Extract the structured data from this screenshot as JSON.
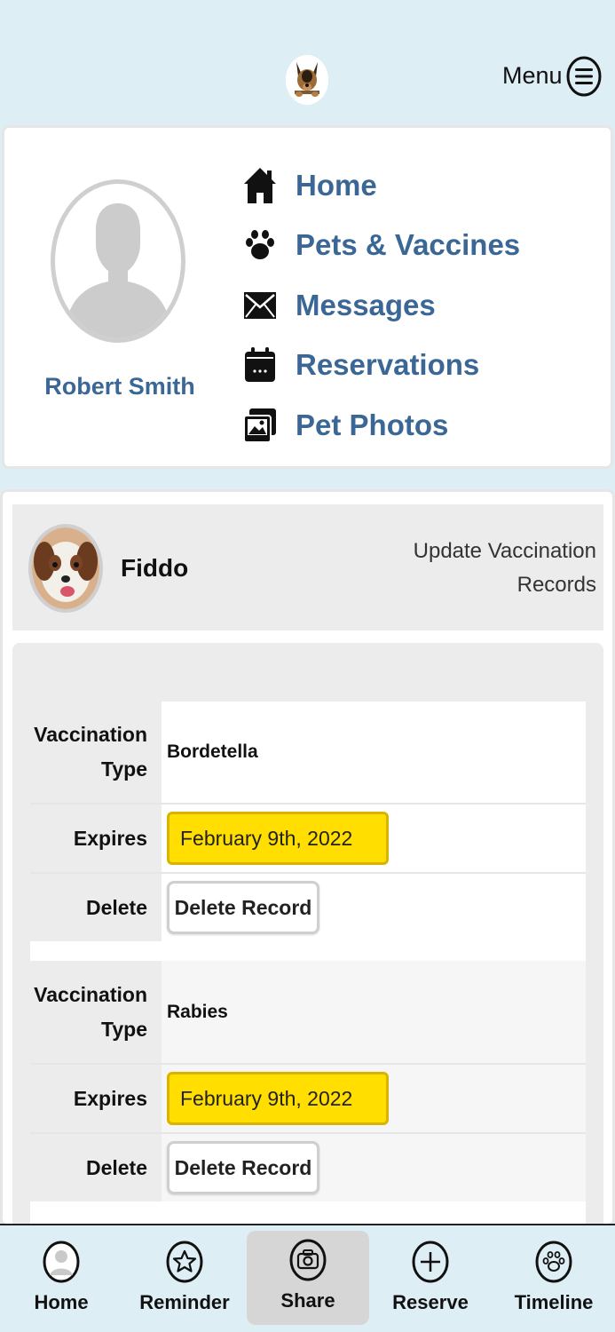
{
  "header": {
    "menu_label": "Menu"
  },
  "profile": {
    "user_name": "Robert Smith",
    "nav": [
      {
        "label": "Home",
        "icon": "home-icon"
      },
      {
        "label": "Pets & Vaccines",
        "icon": "paw-icon"
      },
      {
        "label": "Messages",
        "icon": "envelope-icon"
      },
      {
        "label": "Reservations",
        "icon": "calendar-icon"
      },
      {
        "label": "Pet Photos",
        "icon": "photos-icon"
      }
    ]
  },
  "pet": {
    "name": "Fiddo",
    "update_link": "Update Vaccination Records",
    "records": [
      {
        "type_label_line1": "Vaccination",
        "type_label_line2": "Type",
        "type_value": "Bordetella",
        "expires_label": "Expires",
        "expires_value": "February 9th, 2022",
        "delete_label": "Delete",
        "delete_button": "Delete Record"
      },
      {
        "type_label_line1": "Vaccination",
        "type_label_line2": "Type",
        "type_value": "Rabies",
        "expires_label": "Expires",
        "expires_value": "February 9th, 2022",
        "delete_label": "Delete",
        "delete_button": "Delete Record"
      }
    ]
  },
  "tabbar": {
    "tabs": [
      {
        "label": "Home",
        "icon": "user-avatar-icon"
      },
      {
        "label": "Reminder",
        "icon": "star-icon"
      },
      {
        "label": "Share",
        "icon": "camera-icon",
        "active": true
      },
      {
        "label": "Reserve",
        "icon": "plus-circle-icon"
      },
      {
        "label": "Timeline",
        "icon": "paw-circle-icon"
      }
    ]
  },
  "colors": {
    "background": "#deeef5",
    "link_blue": "#3a6795",
    "date_highlight": "#ffde00",
    "panel_gray": "#ececec"
  }
}
